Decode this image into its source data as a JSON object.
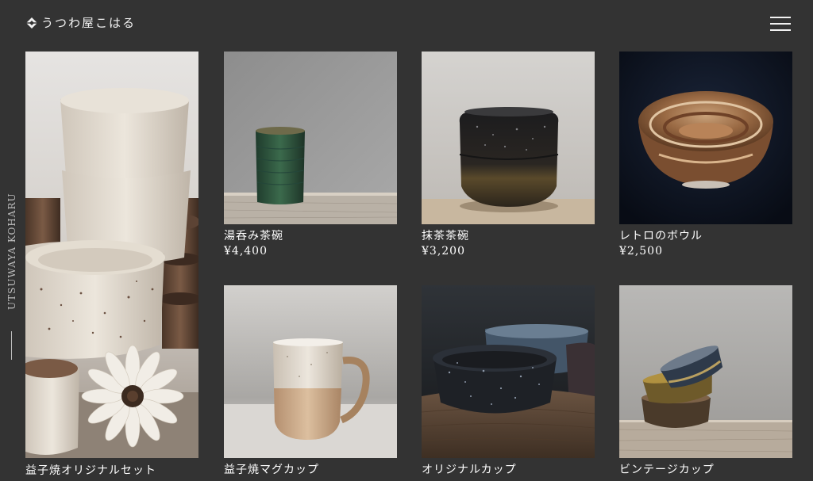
{
  "header": {
    "brand_name": "うつわ屋こはる",
    "menu_icon": "hamburger-menu-icon"
  },
  "side": {
    "vertical_text": "UTSUWAYA KOHARU"
  },
  "products": [
    {
      "name": "益子焼オリジナルセット",
      "price": ""
    },
    {
      "name": "湯呑み茶碗",
      "price": "¥4,400"
    },
    {
      "name": "抹茶茶碗",
      "price": "¥3,200"
    },
    {
      "name": "レトロのボウル",
      "price": "¥2,500"
    },
    {
      "name": "益子焼マグカップ",
      "price": ""
    },
    {
      "name": "オリジナルカップ",
      "price": ""
    },
    {
      "name": "ビンテージカップ",
      "price": ""
    }
  ],
  "colors": {
    "background": "#333333",
    "text": "#ffffff",
    "muted": "#bdbdbd"
  }
}
